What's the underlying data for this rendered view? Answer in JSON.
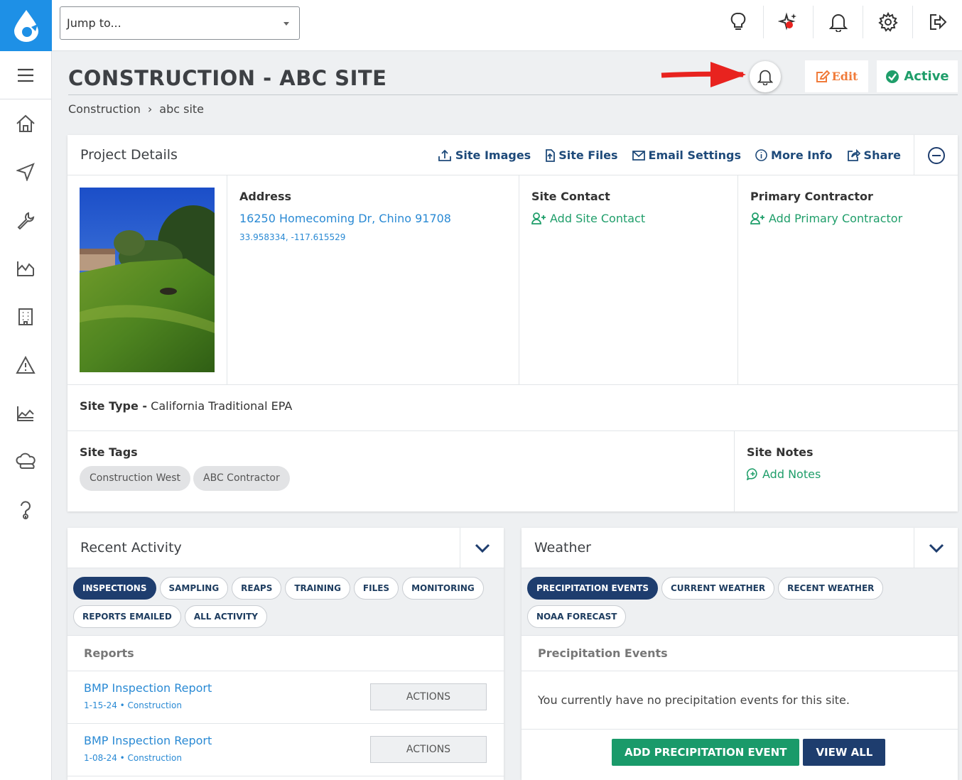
{
  "header": {
    "jump_placeholder": "Jump to...",
    "icons": [
      "lightbulb-icon",
      "sparkle-icon",
      "bell-icon",
      "gear-icon",
      "logout-icon"
    ]
  },
  "sidebar": {
    "icons": [
      "menu-icon",
      "home-icon",
      "navigation-icon",
      "wrench-icon",
      "chart-icon",
      "building-icon",
      "warning-icon",
      "area-chart-icon",
      "cloud-icon",
      "help-icon"
    ]
  },
  "page": {
    "title": "CONSTRUCTION - ABC SITE",
    "breadcrumb": [
      "Construction",
      "›",
      "abc site"
    ],
    "edit_label": "Edit",
    "status_label": "Active"
  },
  "colors": {
    "brand_blue": "#1e90e6",
    "navy": "#1e3d6e",
    "green": "#1f9e6a",
    "orange": "#f07b3a",
    "link_blue": "#2a8ad4",
    "annotation_red": "#e8231f"
  },
  "project": {
    "heading": "Project Details",
    "links": [
      "Site Images",
      "Site Files",
      "Email Settings",
      "More Info",
      "Share"
    ],
    "address_title": "Address",
    "address": "16250 Homecoming Dr, Chino 91708",
    "coords": "33.958334, -117.615529",
    "contact_title": "Site Contact",
    "contact_link": "Add Site Contact",
    "contractor_title": "Primary Contractor",
    "contractor_link": "Add Primary Contractor",
    "site_type_label": "Site Type -",
    "site_type_value": "California Traditional EPA",
    "tags_title": "Site Tags",
    "tags": [
      "Construction West",
      "ABC Contractor"
    ],
    "notes_title": "Site Notes",
    "notes_link": "Add Notes"
  },
  "activity": {
    "heading": "Recent Activity",
    "pills": [
      "INSPECTIONS",
      "SAMPLING",
      "REAPS",
      "TRAINING",
      "FILES",
      "MONITORING",
      "REPORTS EMAILED",
      "ALL ACTIVITY"
    ],
    "sub_heading": "Reports",
    "rows": [
      {
        "title": "BMP Inspection Report",
        "meta": "1-15-24 • Construction",
        "action": "ACTIONS"
      },
      {
        "title": "BMP Inspection Report",
        "meta": "1-08-24 • Construction",
        "action": "ACTIONS"
      }
    ]
  },
  "weather": {
    "heading": "Weather",
    "pills": [
      "PRECIPITATION EVENTS",
      "CURRENT WEATHER",
      "RECENT WEATHER",
      "NOAA FORECAST"
    ],
    "sub_heading": "Precipitation Events",
    "empty_message": "You currently have no precipitation events for this site.",
    "add_button": "ADD PRECIPITATION EVENT",
    "view_all_button": "VIEW ALL"
  }
}
